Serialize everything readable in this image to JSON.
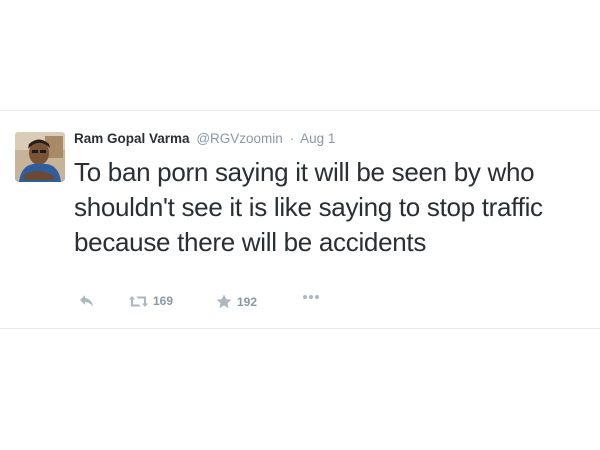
{
  "tweet": {
    "author_name": "Ram Gopal Varma",
    "handle": "@RGVzoomin",
    "separator": "·",
    "date": "Aug 1",
    "text": "To ban porn saying it will be seen by who shouldn't see it is like saying to stop traffic because there will be accidents",
    "retweet_count": "169",
    "favorite_count": "192"
  },
  "icons": {
    "reply": "reply-icon",
    "retweet": "retweet-icon",
    "favorite": "star-icon",
    "more": "more-dots-icon"
  },
  "colors": {
    "text": "#292f33",
    "muted": "#8899a6",
    "icon": "#aab8c2",
    "divider": "#e8ecee"
  }
}
